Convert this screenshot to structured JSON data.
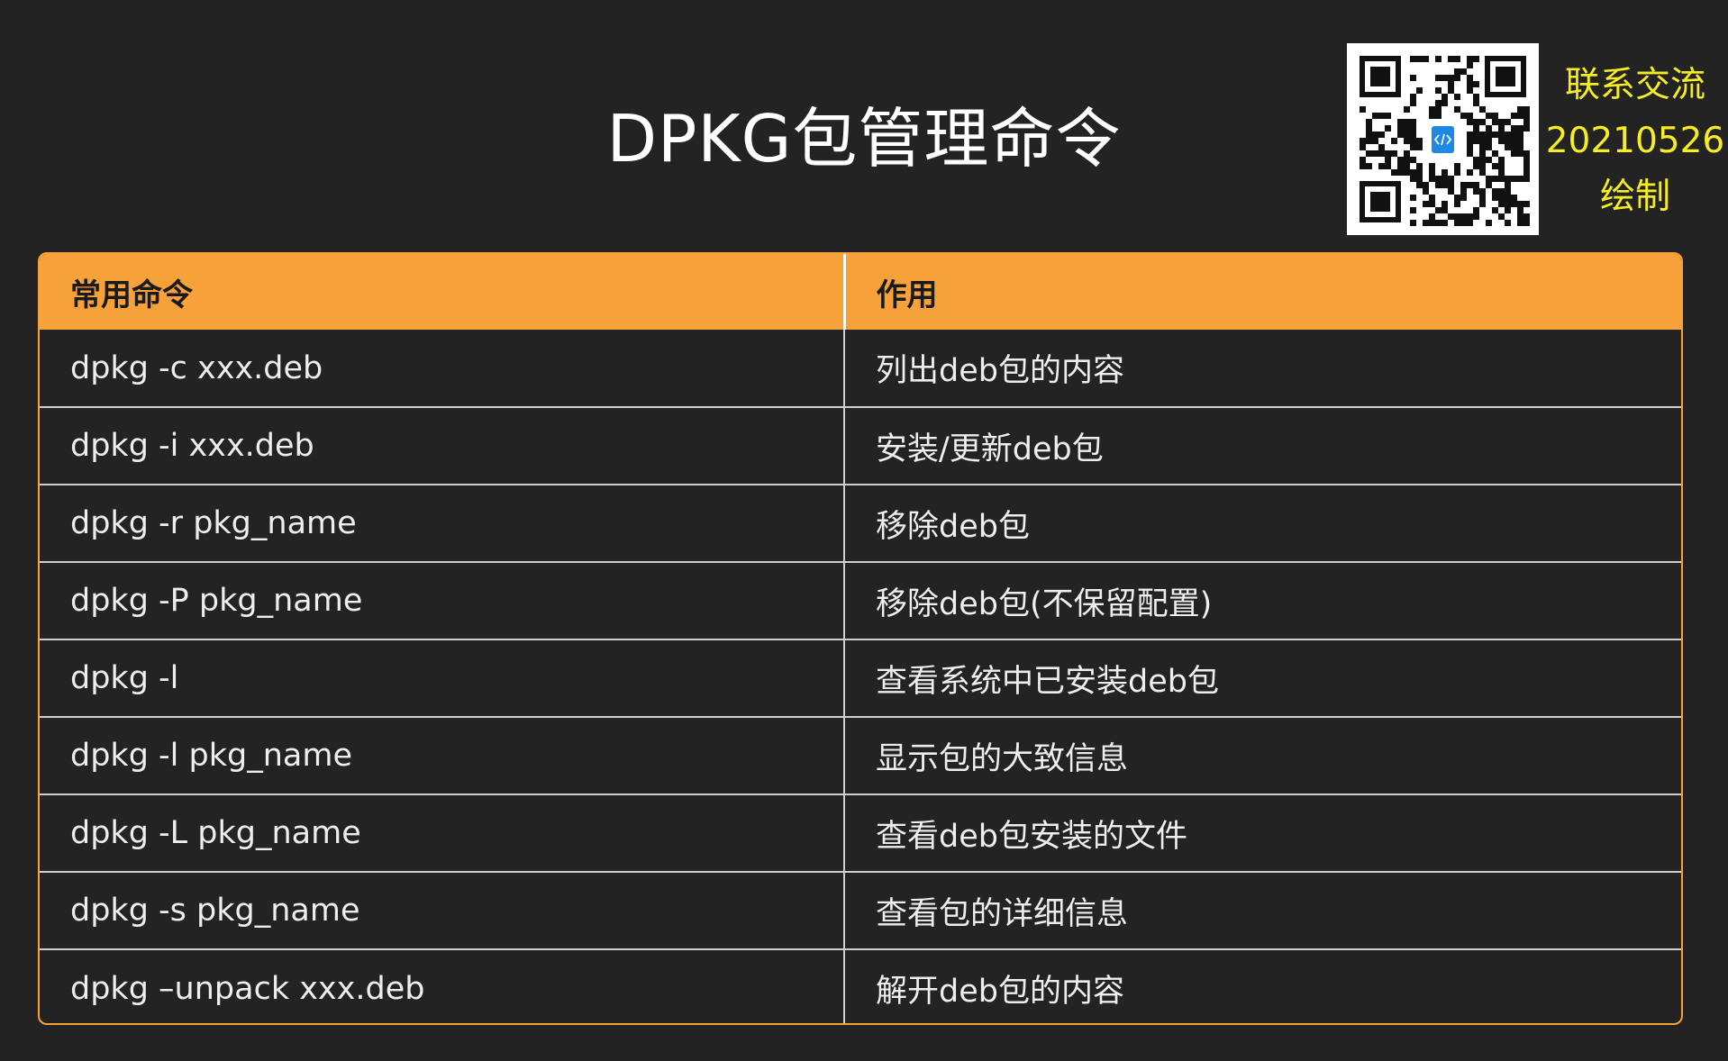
{
  "title": "DPKG包管理命令",
  "qr_code": {
    "center_icon": "code-file-icon"
  },
  "contact": {
    "line1": "联系交流",
    "line2": "20210526",
    "line3": "绘制"
  },
  "table": {
    "headers": [
      "常用命令",
      "作用"
    ],
    "rows": [
      {
        "command": "dpkg -c xxx.deb",
        "description": "列出deb包的内容"
      },
      {
        "command": "dpkg -i xxx.deb",
        "description": "安装/更新deb包"
      },
      {
        "command": "dpkg -r pkg_name",
        "description": "移除deb包"
      },
      {
        "command": "dpkg -P pkg_name",
        "description": "移除deb包(不保留配置)"
      },
      {
        "command": "dpkg -l",
        "description": "查看系统中已安装deb包"
      },
      {
        "command": "dpkg -l pkg_name",
        "description": "显示包的大致信息"
      },
      {
        "command": "dpkg -L pkg_name",
        "description": "查看deb包安装的文件"
      },
      {
        "command": "dpkg -s pkg_name",
        "description": "查看包的详细信息"
      },
      {
        "command": "dpkg –unpack xxx.deb",
        "description": "解开deb包的内容"
      }
    ]
  },
  "colors": {
    "background": "#232323",
    "header_accent": "#f7a13a",
    "contact_text": "#f7ee22",
    "text": "#eeeeee"
  }
}
